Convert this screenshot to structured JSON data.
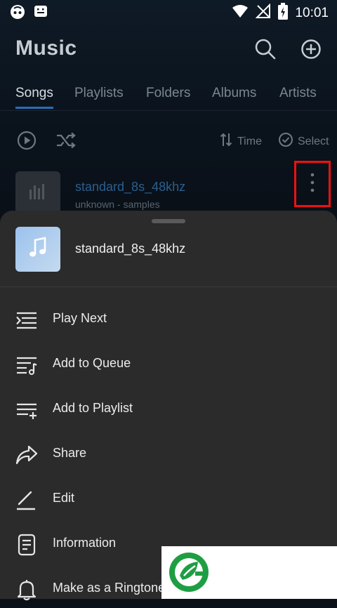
{
  "status": {
    "time": "10:01"
  },
  "header": {
    "title": "Music"
  },
  "tabs": [
    {
      "label": "Songs"
    },
    {
      "label": "Playlists"
    },
    {
      "label": "Folders"
    },
    {
      "label": "Albums"
    },
    {
      "label": "Artists"
    }
  ],
  "actions": {
    "sort_label": "Time",
    "select_label": "Select"
  },
  "song": {
    "title": "standard_8s_48khz",
    "subtitle": "unknown - samples"
  },
  "sheet": {
    "title": "standard_8s_48khz",
    "menu": [
      {
        "label": "Play Next",
        "icon": "play-next-icon"
      },
      {
        "label": "Add to Queue",
        "icon": "add-to-queue-icon"
      },
      {
        "label": "Add to Playlist",
        "icon": "add-to-playlist-icon"
      },
      {
        "label": "Share",
        "icon": "share-icon"
      },
      {
        "label": "Edit",
        "icon": "edit-icon"
      },
      {
        "label": "Information",
        "icon": "information-icon"
      },
      {
        "label": "Make as a Ringtone",
        "icon": "bell-icon"
      }
    ]
  },
  "colors": {
    "accent": "#2b6db3",
    "highlight": "#ee1111",
    "sheet_bg": "#2b2b2b"
  }
}
